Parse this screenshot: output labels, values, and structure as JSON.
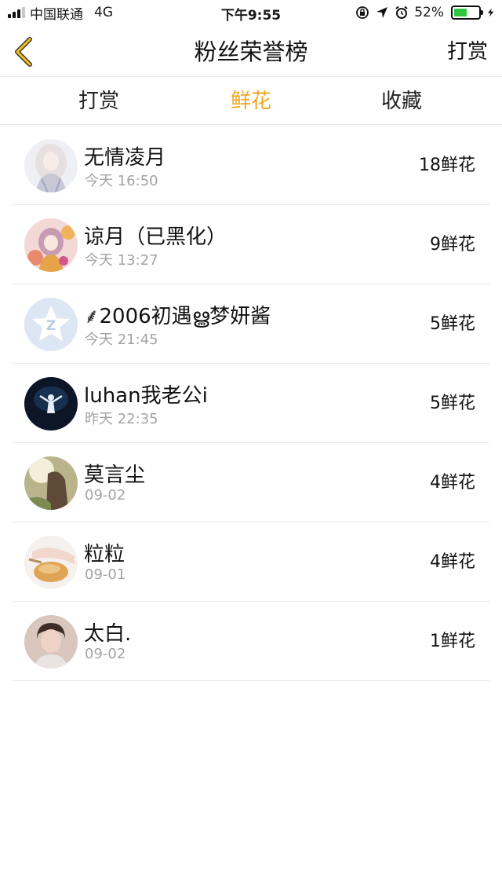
{
  "status_bar": {
    "carrier": "中国联通",
    "network": "4G",
    "time": "下午9:55",
    "battery_percent": "52%",
    "battery_level": 0.52
  },
  "nav": {
    "title": "粉丝荣誉榜",
    "right_action": "打赏",
    "accent_color": "#f0a820"
  },
  "tabs": [
    {
      "label": "打赏",
      "active": false
    },
    {
      "label": "鲜花",
      "active": true
    },
    {
      "label": "收藏",
      "active": false
    }
  ],
  "fans": [
    {
      "name": "无情凌月",
      "time": "今天 16:50",
      "count": "18鲜花"
    },
    {
      "name": "谅月（已黑化）",
      "time": "今天 13:27",
      "count": "9鲜花"
    },
    {
      "name": "⸙2006初遇ൠ梦妍酱",
      "time": "今天 21:45",
      "count": "5鲜花"
    },
    {
      "name": "luhan我老公i",
      "time": "昨天 22:35",
      "count": "5鲜花"
    },
    {
      "name": "莫言尘",
      "time": "09-02",
      "count": "4鲜花"
    },
    {
      "name": "粒粒",
      "time": "09-01",
      "count": "4鲜花"
    },
    {
      "name": "太白.",
      "time": "09-02",
      "count": "1鲜花"
    }
  ]
}
